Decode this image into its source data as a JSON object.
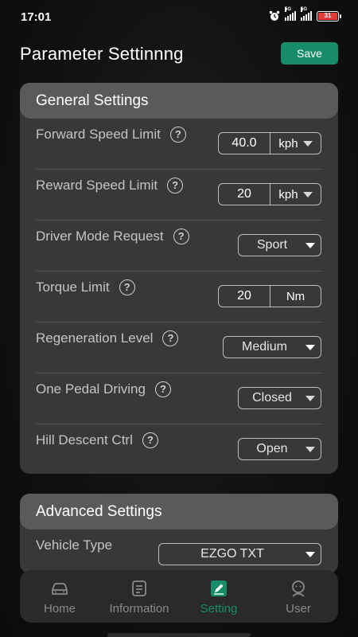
{
  "status": {
    "time": "17:01",
    "sim1": "5G",
    "sim2": "5G",
    "battery": "31"
  },
  "header": {
    "title": "Parameter Settinnng",
    "save_label": "Save"
  },
  "general": {
    "title": "General Settings",
    "forward_speed": {
      "label": "Forward Speed Limit",
      "value": "40.0",
      "unit": "kph"
    },
    "reward_speed": {
      "label": "Reward Speed Limit",
      "value": "20",
      "unit": "kph"
    },
    "driver_mode": {
      "label": "Driver Mode Request",
      "value": "Sport"
    },
    "torque": {
      "label": "Torque Limit",
      "value": "20",
      "unit": "Nm"
    },
    "regen": {
      "label": "Regeneration Level",
      "value": "Medium"
    },
    "one_pedal": {
      "label": "One Pedal Driving",
      "value": "Closed"
    },
    "hill_descent": {
      "label": "Hill Descent Ctrl",
      "value": "Open"
    }
  },
  "advanced": {
    "title": "Advanced Settings",
    "vehicle_type": {
      "label": "Vehicle Type",
      "value": "EZGO TXT"
    }
  },
  "nav": {
    "home": "Home",
    "information": "Information",
    "setting": "Setting",
    "user": "User"
  },
  "colors": {
    "accent": "#178c68",
    "card": "#383838",
    "card_header": "#5a5a5a"
  }
}
